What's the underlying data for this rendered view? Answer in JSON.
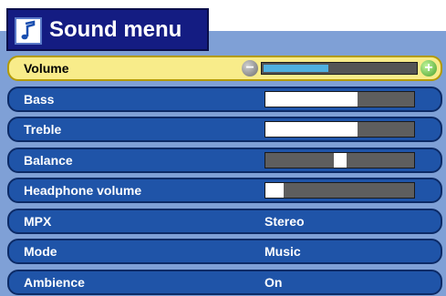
{
  "menu": {
    "title": "Sound menu",
    "title_icon": "music-note-icon",
    "items": [
      {
        "id": "volume",
        "label": "Volume",
        "selected": true,
        "type": "slider",
        "level": 0.42
      },
      {
        "id": "bass",
        "label": "Bass",
        "selected": false,
        "type": "slider",
        "level": 0.62
      },
      {
        "id": "treble",
        "label": "Treble",
        "selected": false,
        "type": "slider",
        "level": 0.62
      },
      {
        "id": "balance",
        "label": "Balance",
        "selected": false,
        "type": "balance",
        "level": 0.5
      },
      {
        "id": "headphone-volume",
        "label": "Headphone volume",
        "selected": false,
        "type": "slider",
        "level": 0.12
      },
      {
        "id": "mpx",
        "label": "MPX",
        "selected": false,
        "type": "value",
        "value": "Stereo"
      },
      {
        "id": "mode",
        "label": "Mode",
        "selected": false,
        "type": "value",
        "value": "Music"
      },
      {
        "id": "ambience",
        "label": "Ambience",
        "selected": false,
        "type": "value",
        "value": "On"
      }
    ],
    "volume_controls": {
      "minus_label": "−",
      "plus_label": "+"
    }
  },
  "colors": {
    "row": "#1f54a8",
    "row_selected": "#f8ec8a",
    "panel": "#7fa0d6",
    "title": "#141c82",
    "volume_fill": "#4fb0e0"
  }
}
